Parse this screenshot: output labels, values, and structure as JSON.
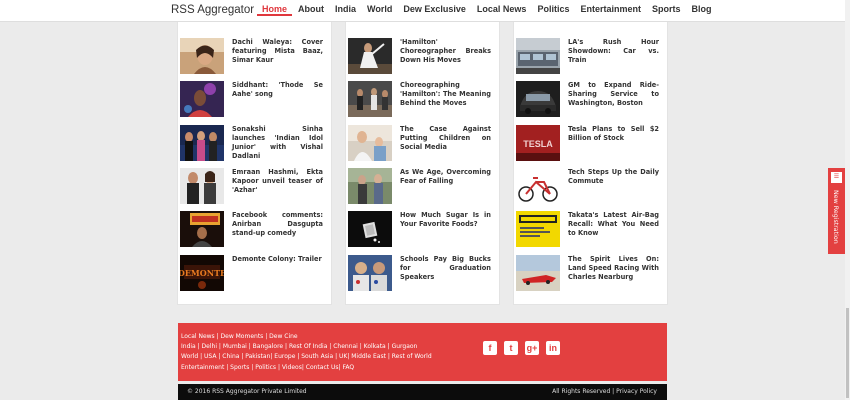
{
  "brand": "RSS Aggregator",
  "nav": [
    "Home",
    "About",
    "India",
    "World",
    "Dew Exclusive",
    "Local News",
    "Politics",
    "Entertainment",
    "Sports",
    "Blog"
  ],
  "columns": [
    [
      "Dachi Waleya: Cover featuring Mista Baaz, Simar Kaur",
      "Siddhant: 'Thode Se Aahe' song",
      "Sonakshi Sinha launches 'Indian Idol Junior' with Vishal Dadlani",
      "Emraan Hashmi, Ekta Kapoor unveil teaser of 'Azhar'",
      "Facebook comments: Anirban Dasgupta stand-up comedy",
      "Demonte Colony: Trailer"
    ],
    [
      "'Hamilton' Choreographer Breaks Down His Moves",
      "Choreographing 'Hamilton': The Meaning Behind the Moves",
      "The Case Against Putting Children on Social Media",
      "As We Age, Overcoming Fear of Falling",
      "How Much Sugar Is in Your Favorite Foods?",
      "Schools Pay Big Bucks for Graduation Speakers"
    ],
    [
      "LA's Rush Hour Showdown: Car vs. Train",
      "GM to Expand Ride-Sharing Service to Washington, Boston",
      "Tesla Plans to Sell $2 Billion of Stock",
      "Tech Steps Up the Daily Commute",
      "Takata's Latest Air-Bag Recall: What You Need to Know",
      "The Spirit Lives On: Land Speed Racing With Charles Nearburg"
    ]
  ],
  "footer_rows": [
    "Local News | Dew Moments | Dew Cine",
    "India | Delhi | Mumbai | Bangalore | Rest Of India | Chennai | Kolkata | Gurgaon",
    "World | USA | China | Pakistan| Europe | South Asia | UK| Middle East | Rest of World",
    "Entertainment | Sports | Politics | Videos| Contact Us| FAQ"
  ],
  "social": [
    "f",
    "t",
    "g+",
    "in"
  ],
  "copyright": "© 2016 RSS Aggregator Private Limited",
  "rights": "All Rights Reserved | Privacy Policy",
  "sidetab": "New Registration",
  "colors": {
    "accent": "#e34040",
    "footer_bottom": "#0c0c0c"
  }
}
